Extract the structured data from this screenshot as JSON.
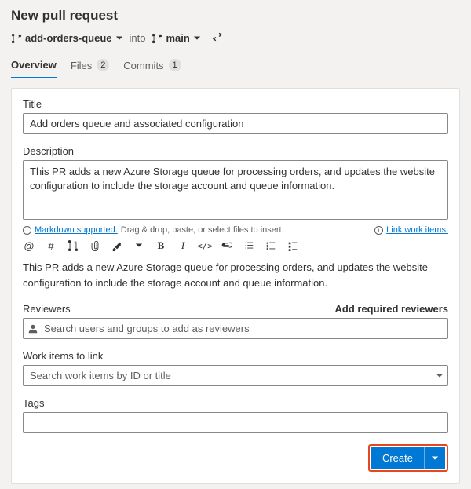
{
  "header": {
    "page_title": "New pull request",
    "source_branch": "add-orders-queue",
    "into_label": "into",
    "target_branch": "main"
  },
  "tabs": {
    "overview": "Overview",
    "files": "Files",
    "files_count": "2",
    "commits": "Commits",
    "commits_count": "1"
  },
  "form": {
    "title_label": "Title",
    "title_value": "Add orders queue and associated configuration",
    "desc_label": "Description",
    "desc_value": "This PR adds a new Azure Storage queue for processing orders, and updates the website configuration to include the storage account and queue information.",
    "markdown_link": "Markdown supported.",
    "markdown_suffix": " Drag & drop, paste, or select files to insert.",
    "link_work_items": "Link work items.",
    "preview_text": "This PR adds a new Azure Storage queue for processing orders, and updates the website configuration to include the storage account and queue information.",
    "reviewers_label": "Reviewers",
    "add_required": "Add required reviewers",
    "reviewers_placeholder": "Search users and groups to add as reviewers",
    "workitems_label": "Work items to link",
    "workitems_placeholder": "Search work items by ID or title",
    "tags_label": "Tags",
    "create_label": "Create"
  }
}
